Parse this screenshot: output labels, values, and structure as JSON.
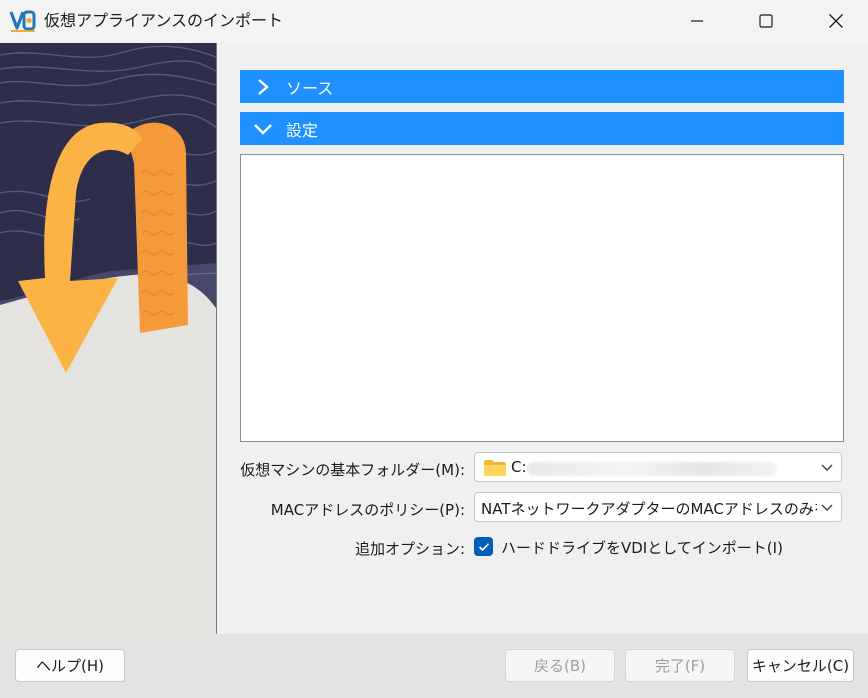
{
  "window": {
    "title": "仮想アプライアンスのインポート",
    "app_icon": "virtualbox-icon",
    "controls": [
      "minimize-icon",
      "maximize-icon",
      "close-icon"
    ]
  },
  "sections": {
    "source": {
      "label": "ソース",
      "expanded": false
    },
    "settings": {
      "label": "設定",
      "expanded": true
    }
  },
  "form": {
    "base_folder_label": "仮想マシンの基本フォルダー(M):",
    "base_folder_value": "C:",
    "mac_policy_label": "MACアドレスのポリシー(P):",
    "mac_policy_value": "NATネットワークアダプターのMACアドレスのみを含む",
    "additional_options_label": "追加オプション:",
    "import_vdi_label": "ハードドライブをVDIとしてインポート(I)",
    "import_vdi_checked": true
  },
  "buttons": {
    "help": "ヘルプ(H)",
    "back": "戻る(B)",
    "finish": "完了(F)",
    "cancel": "キャンセル(C)"
  },
  "colors": {
    "section_header": "#1e90ff",
    "checkbox": "#005fb8",
    "art_arrow": "#fbb346",
    "art_ribbon": "#f59a3a",
    "art_sky": "#2f2e4a"
  }
}
